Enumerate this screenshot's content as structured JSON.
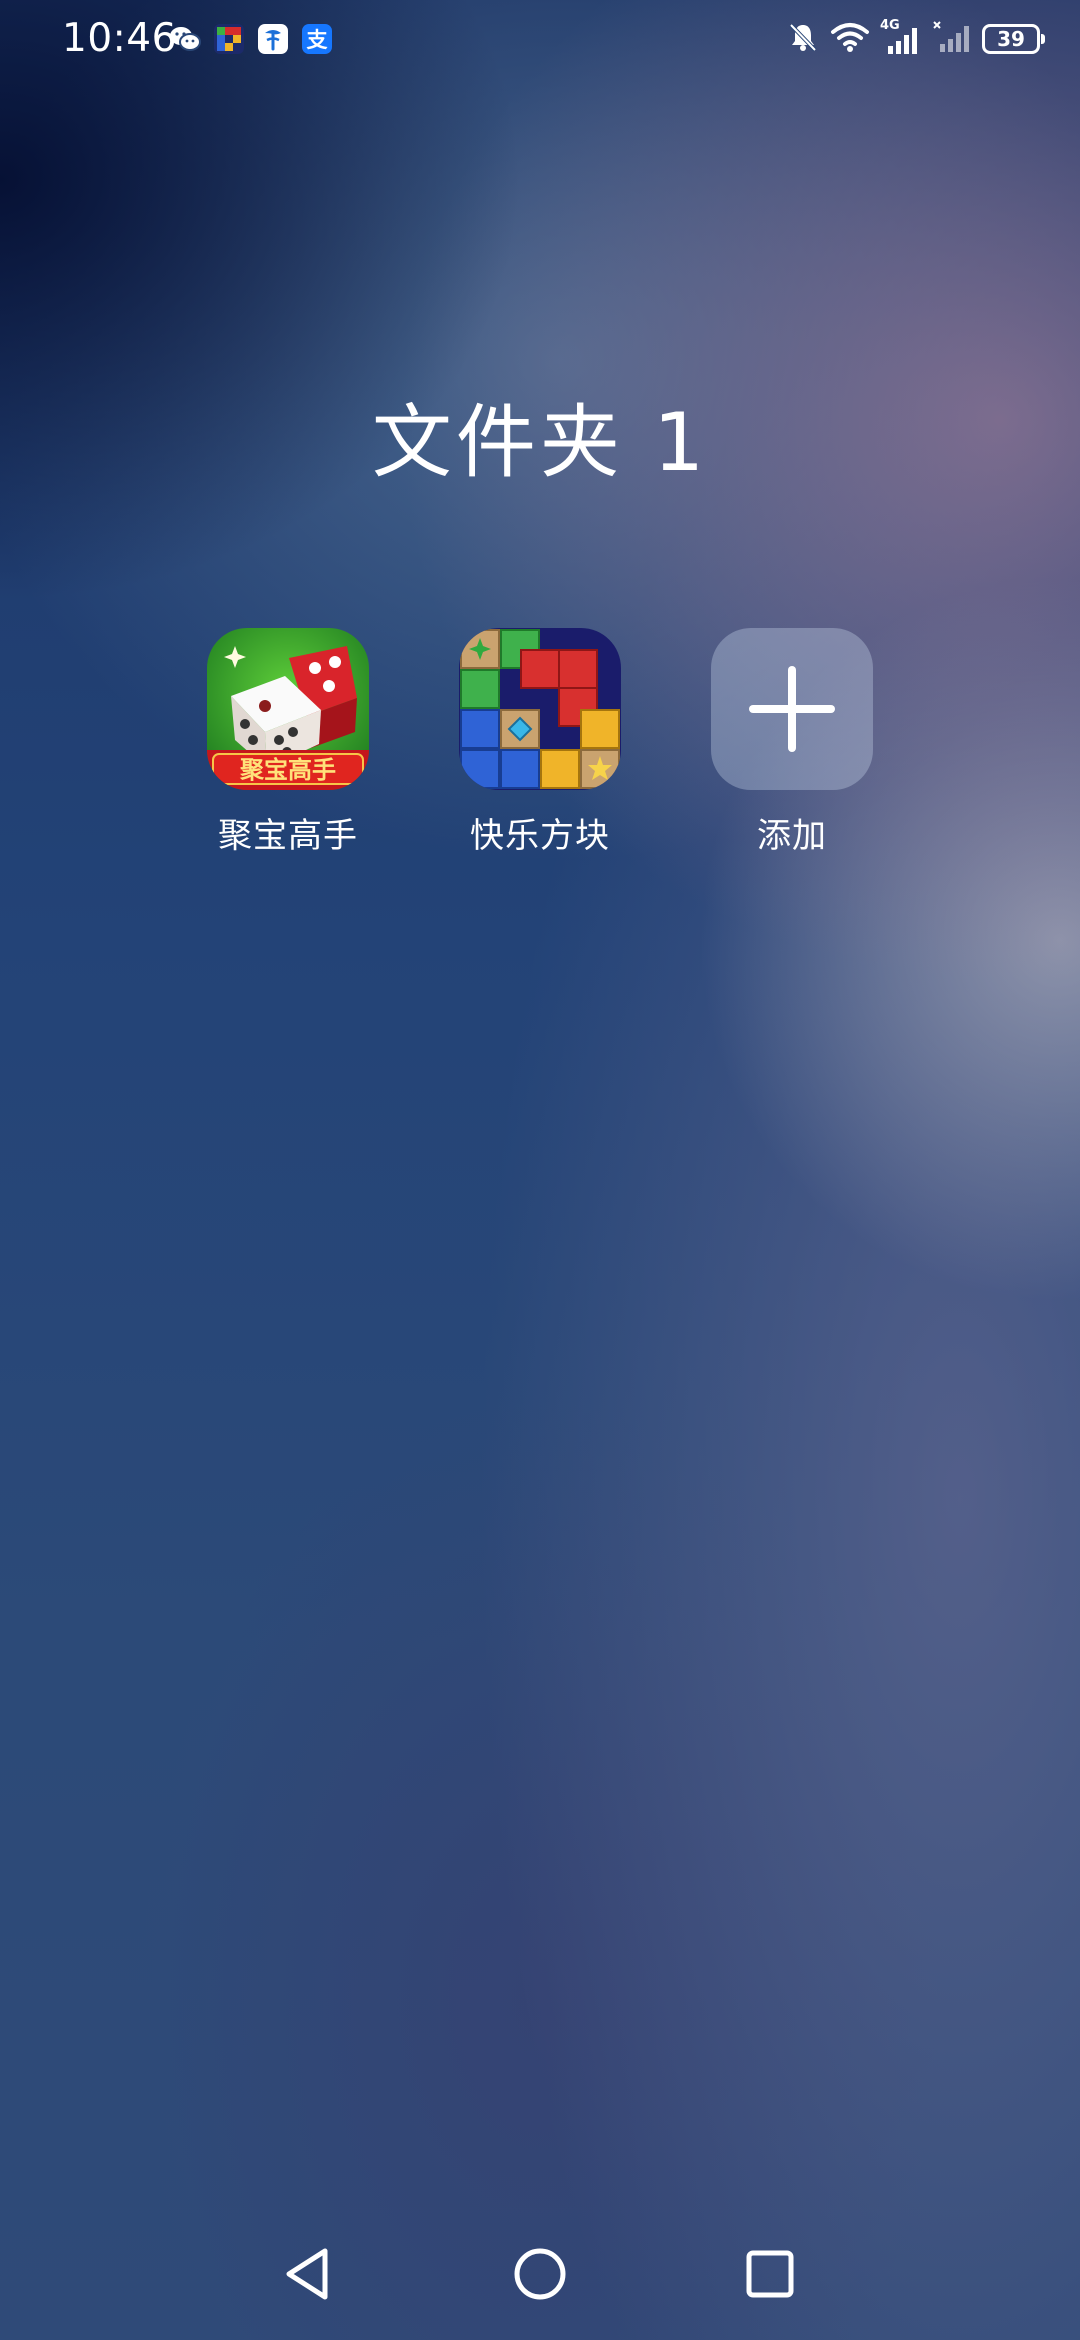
{
  "status_bar": {
    "time": "10:46",
    "notification_icons": [
      "wechat-icon",
      "game-app-icon",
      "telecom-icon",
      "alipay-icon"
    ],
    "alipay_glyph": "支",
    "network_type": "4G",
    "battery_level": "39"
  },
  "folder": {
    "title": "文件夹 1",
    "apps": [
      {
        "label": "聚宝高手",
        "icon": "dice-game-icon",
        "banner": "聚宝高手"
      },
      {
        "label": "快乐方块",
        "icon": "block-puzzle-icon"
      },
      {
        "label": "添加",
        "icon": "plus-icon"
      }
    ]
  },
  "nav_bar": {
    "buttons": [
      "back-icon",
      "home-icon",
      "recents-icon"
    ]
  },
  "colors": {
    "text": "#ffffff",
    "add_tile": "rgba(200,215,235,0.35)"
  }
}
